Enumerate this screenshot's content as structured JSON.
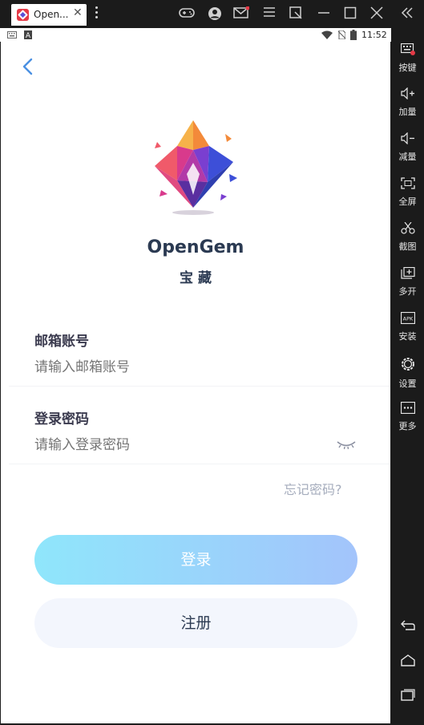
{
  "window": {
    "tab_title": "Open...",
    "tab_close": "✕"
  },
  "android_status": {
    "time": "11:52"
  },
  "sidebar": {
    "items": [
      {
        "label": "按键",
        "icon": "keyboard-icon"
      },
      {
        "label": "加量",
        "icon": "volume-up-icon"
      },
      {
        "label": "减量",
        "icon": "volume-down-icon"
      },
      {
        "label": "全屏",
        "icon": "fullscreen-icon"
      },
      {
        "label": "截图",
        "icon": "scissors-icon"
      },
      {
        "label": "多开",
        "icon": "multi-instance-icon"
      },
      {
        "label": "安装",
        "icon": "apk-icon"
      },
      {
        "label": "设置",
        "icon": "gear-icon"
      },
      {
        "label": "更多",
        "icon": "more-icon"
      }
    ]
  },
  "app": {
    "name": "OpenGem",
    "subtitle": "宝 藏",
    "email": {
      "label": "邮箱账号",
      "placeholder": "请输入邮箱账号"
    },
    "password": {
      "label": "登录密码",
      "placeholder": "请输入登录密码"
    },
    "forgot": "忘记密码?",
    "login_button": "登录",
    "register_button": "注册"
  },
  "colors": {
    "accent": "#4a90e2",
    "login_gradient_start": "#8fe6fb",
    "login_gradient_end": "#a3c4fb",
    "register_bg": "#f3f6fd",
    "title_text": "#2b3a52"
  }
}
